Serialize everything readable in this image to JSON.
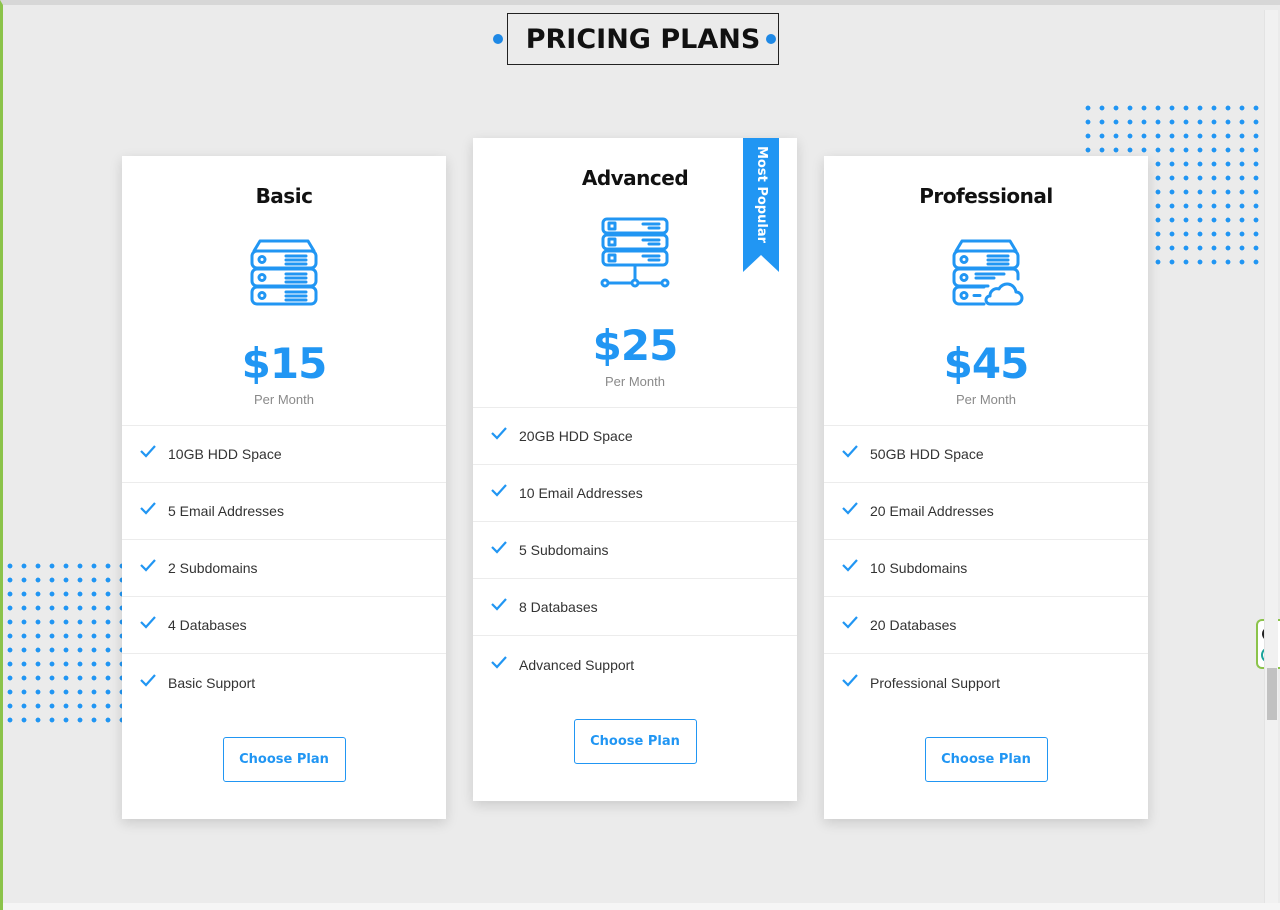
{
  "section": {
    "title": "PRICING PLANS"
  },
  "plans": [
    {
      "name": "Basic",
      "icon": "server-stack-icon",
      "price": "$15",
      "period": "Per Month",
      "features": [
        "10GB HDD Space",
        "5 Email Addresses",
        "2 Subdomains",
        "4 Databases",
        "Basic Support"
      ],
      "cta": "Choose Plan"
    },
    {
      "name": "Advanced",
      "icon": "server-network-icon",
      "price": "$25",
      "period": "Per Month",
      "badge": "Most Popular",
      "features": [
        "20GB HDD Space",
        "10 Email Addresses",
        "5 Subdomains",
        "8 Databases",
        "Advanced Support"
      ],
      "cta": "Choose Plan"
    },
    {
      "name": "Professional",
      "icon": "server-cloud-icon",
      "price": "$45",
      "period": "Per Month",
      "features": [
        "50GB HDD Space",
        "20 Email Addresses",
        "10 Subdomains",
        "20 Databases",
        "Professional Support"
      ],
      "cta": "Choose Plan"
    }
  ],
  "extension_widget": {
    "close_glyph": "✕",
    "logo_glyph": "e"
  },
  "colors": {
    "accent": "#2196f3",
    "background": "#ebebeb",
    "card": "#ffffff",
    "frame": "#8bc34a"
  }
}
